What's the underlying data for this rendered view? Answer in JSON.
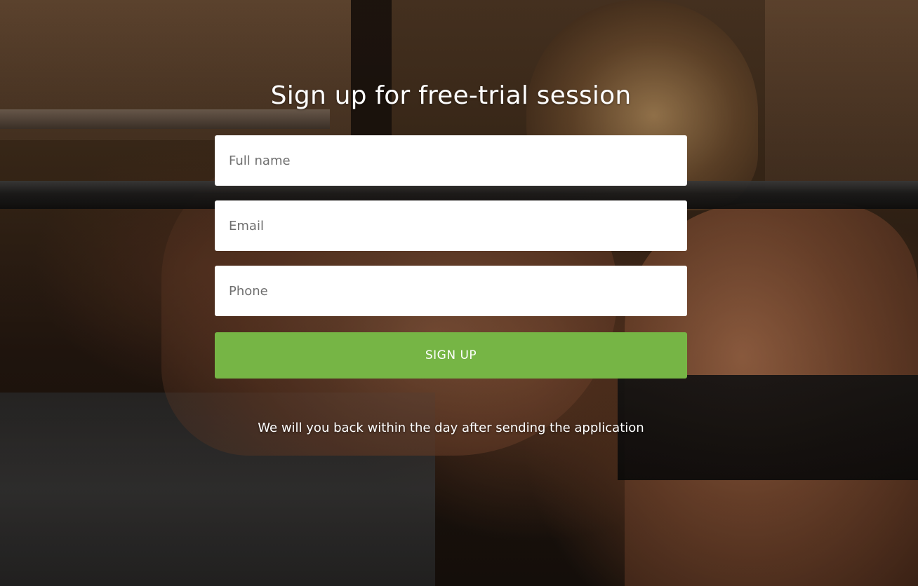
{
  "page": {
    "background_image": "gym-woman-barbell-photo"
  },
  "form": {
    "title": "Sign up for free-trial session",
    "fields": {
      "full_name": {
        "placeholder": "Full name",
        "value": ""
      },
      "email": {
        "placeholder": "Email",
        "value": ""
      },
      "phone": {
        "placeholder": "Phone",
        "value": ""
      }
    },
    "submit_label": "SIGN UP",
    "note": "We will you back within the day after sending the application"
  },
  "colors": {
    "button": "#76b545",
    "text": "#ffffff",
    "field_background": "#ffffff"
  }
}
